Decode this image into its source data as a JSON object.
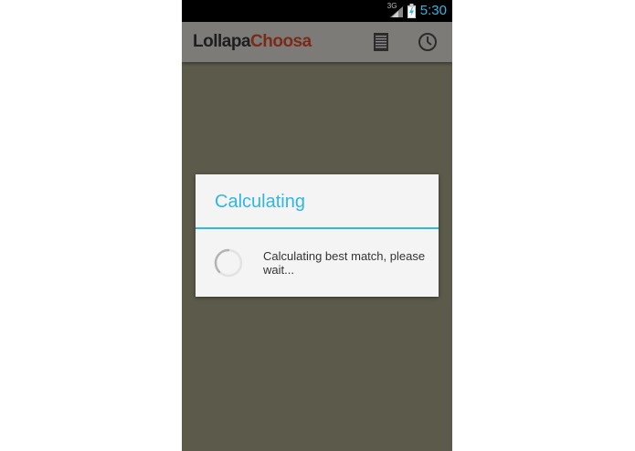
{
  "status_bar": {
    "network": "3G",
    "time": "5:30",
    "icons": [
      "signal-icon",
      "battery-charging-icon"
    ]
  },
  "action_bar": {
    "title_part1": "Lollapa",
    "title_part2": "Choosa",
    "icons": [
      "list-icon",
      "clock-icon"
    ]
  },
  "dialog": {
    "title": "Calculating",
    "message": "Calculating best match, please wait...",
    "icon": "spinner-icon"
  },
  "colors": {
    "accent": "#33b5e5",
    "background": "#5c5a4a",
    "action_bar": "#7c7b78",
    "title_part2": "#7a2b18"
  }
}
